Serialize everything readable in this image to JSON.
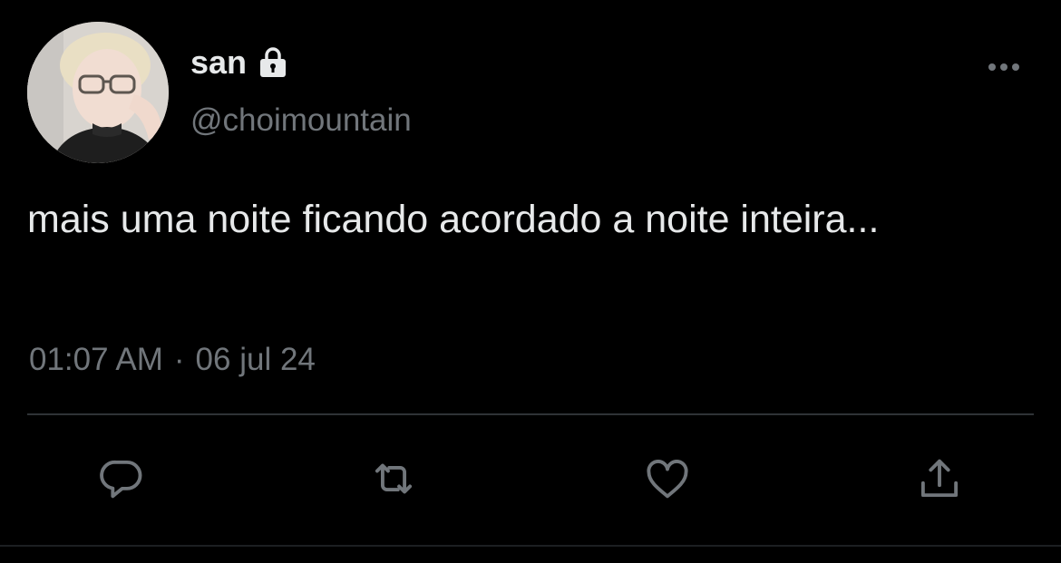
{
  "user": {
    "display_name": "san",
    "handle": "@choimountain",
    "protected_icon": "lock-icon"
  },
  "tweet": {
    "text": "mais uma noite ficando acordado a noite inteira...",
    "time": "01:07 AM",
    "separator": "·",
    "date": "06 jul 24"
  },
  "actions": [
    {
      "name": "reply",
      "icon": "reply-icon"
    },
    {
      "name": "retweet",
      "icon": "retweet-icon"
    },
    {
      "name": "like",
      "icon": "heart-icon"
    },
    {
      "name": "share",
      "icon": "share-icon"
    }
  ],
  "colors": {
    "background": "#000000",
    "primary_text": "#e7e9ea",
    "secondary_text": "#71767b",
    "divider": "#2f3336"
  }
}
